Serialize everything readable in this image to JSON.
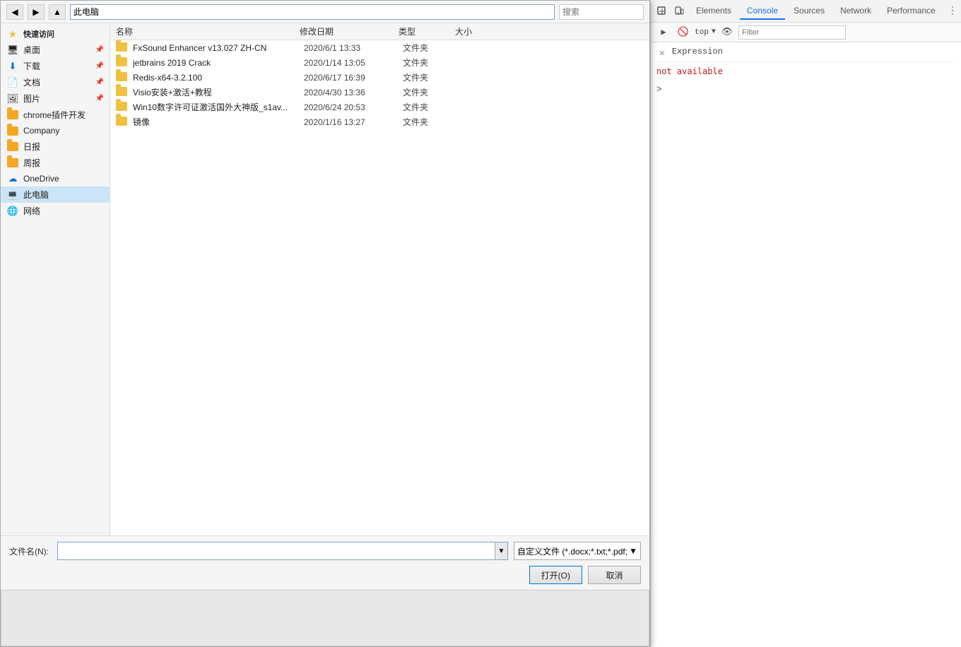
{
  "dialog": {
    "nav": {
      "breadcrumb": "此电脑",
      "search_placeholder": "搜索"
    },
    "sidebar": {
      "sections": [
        {
          "label": "快速访问",
          "items": [
            {
              "name": "桌面",
              "icon": "desktop",
              "pinned": true
            },
            {
              "name": "下载",
              "icon": "download",
              "pinned": true
            },
            {
              "name": "文档",
              "icon": "document",
              "pinned": true
            },
            {
              "name": "图片",
              "icon": "picture",
              "pinned": true
            },
            {
              "name": "chrome插件开发",
              "icon": "folder-orange",
              "pinned": false
            },
            {
              "name": "Company",
              "icon": "folder-orange",
              "pinned": false
            },
            {
              "name": "日报",
              "icon": "folder-orange",
              "pinned": false
            },
            {
              "name": "周报",
              "icon": "folder-orange",
              "pinned": false
            }
          ]
        },
        {
          "label": "",
          "items": [
            {
              "name": "OneDrive",
              "icon": "onedrive",
              "pinned": false
            },
            {
              "name": "此电脑",
              "icon": "computer",
              "pinned": false,
              "selected": true
            },
            {
              "name": "网络",
              "icon": "network",
              "pinned": false
            }
          ]
        }
      ]
    },
    "file_list": {
      "columns": [
        "名称",
        "修改日期",
        "类型",
        "大小"
      ],
      "rows": [
        {
          "name": "FxSound Enhancer v13.027 ZH-CN",
          "date": "2020/6/1 13:33",
          "type": "文件夹",
          "size": ""
        },
        {
          "name": "jetbrains 2019 Crack",
          "date": "2020/1/14 13:05",
          "type": "文件夹",
          "size": ""
        },
        {
          "name": "Redis-x64-3.2.100",
          "date": "2020/6/17 16:39",
          "type": "文件夹",
          "size": ""
        },
        {
          "name": "Visio安装+激活+教程",
          "date": "2020/4/30 13:36",
          "type": "文件夹",
          "size": ""
        },
        {
          "name": "Win10数字许可证激活国外大神版_s1av...",
          "date": "2020/6/24 20:53",
          "type": "文件夹",
          "size": ""
        },
        {
          "name": "镜像",
          "date": "2020/1/16 13:27",
          "type": "文件夹",
          "size": ""
        }
      ]
    },
    "bottom": {
      "filename_label": "文件名(N):",
      "filename_value": "",
      "filetype_label": "自定义文件 (*.docx;*.txt;*.pdf;",
      "open_button": "打开(O)",
      "cancel_button": "取消"
    }
  },
  "devtools": {
    "tabs": [
      "Elements",
      "Console",
      "Sources",
      "Network",
      "Performance"
    ],
    "active_tab": "Console",
    "toolbar_icons": [
      "cursor",
      "device",
      "close"
    ],
    "subbar": {
      "close_label": "×",
      "expression_label": "Expression",
      "not_available": "not available"
    },
    "top_select": {
      "value": "top",
      "arrow": "▼"
    },
    "eye_icon": "👁",
    "filter_placeholder": "Filter",
    "console_prompt": ">"
  }
}
